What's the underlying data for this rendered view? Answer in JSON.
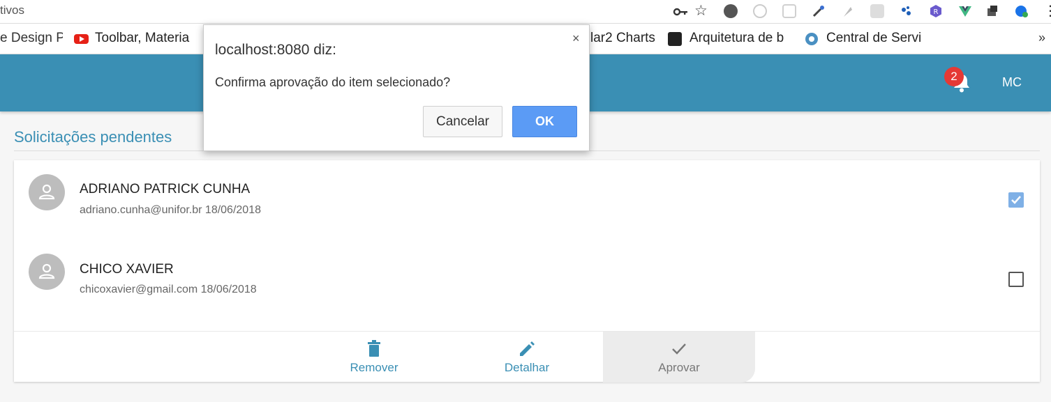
{
  "browser": {
    "url_fragment": "tivos",
    "bookmarks": [
      {
        "label": "e Design P"
      },
      {
        "label": "Toolbar, Materia"
      },
      {
        "label": "lar2 Charts"
      },
      {
        "label": "Arquitetura de b"
      },
      {
        "label": "Central de Servi"
      }
    ],
    "more": "»"
  },
  "header": {
    "notification_count": "2",
    "user_initials": "MC"
  },
  "page": {
    "title": "Solicitações pendentes"
  },
  "list": {
    "items": [
      {
        "name": "ADRIANO PATRICK CUNHA",
        "meta": "adriano.cunha@unifor.br 18/06/2018",
        "checked": true
      },
      {
        "name": "CHICO XAVIER",
        "meta": "chicoxavier@gmail.com 18/06/2018",
        "checked": false
      }
    ]
  },
  "actions": {
    "remove_label": "Remover",
    "detail_label": "Detalhar",
    "approve_label": "Aprovar"
  },
  "dialog": {
    "title": "localhost:8080 diz:",
    "message": "Confirma aprovação do item selecionado?",
    "cancel_label": "Cancelar",
    "ok_label": "OK",
    "close_glyph": "×"
  },
  "colors": {
    "primary": "#3a8fb4",
    "badge": "#e53935",
    "ok_button": "#5b9bf5",
    "checkbox_checked": "#7fb0e6"
  }
}
